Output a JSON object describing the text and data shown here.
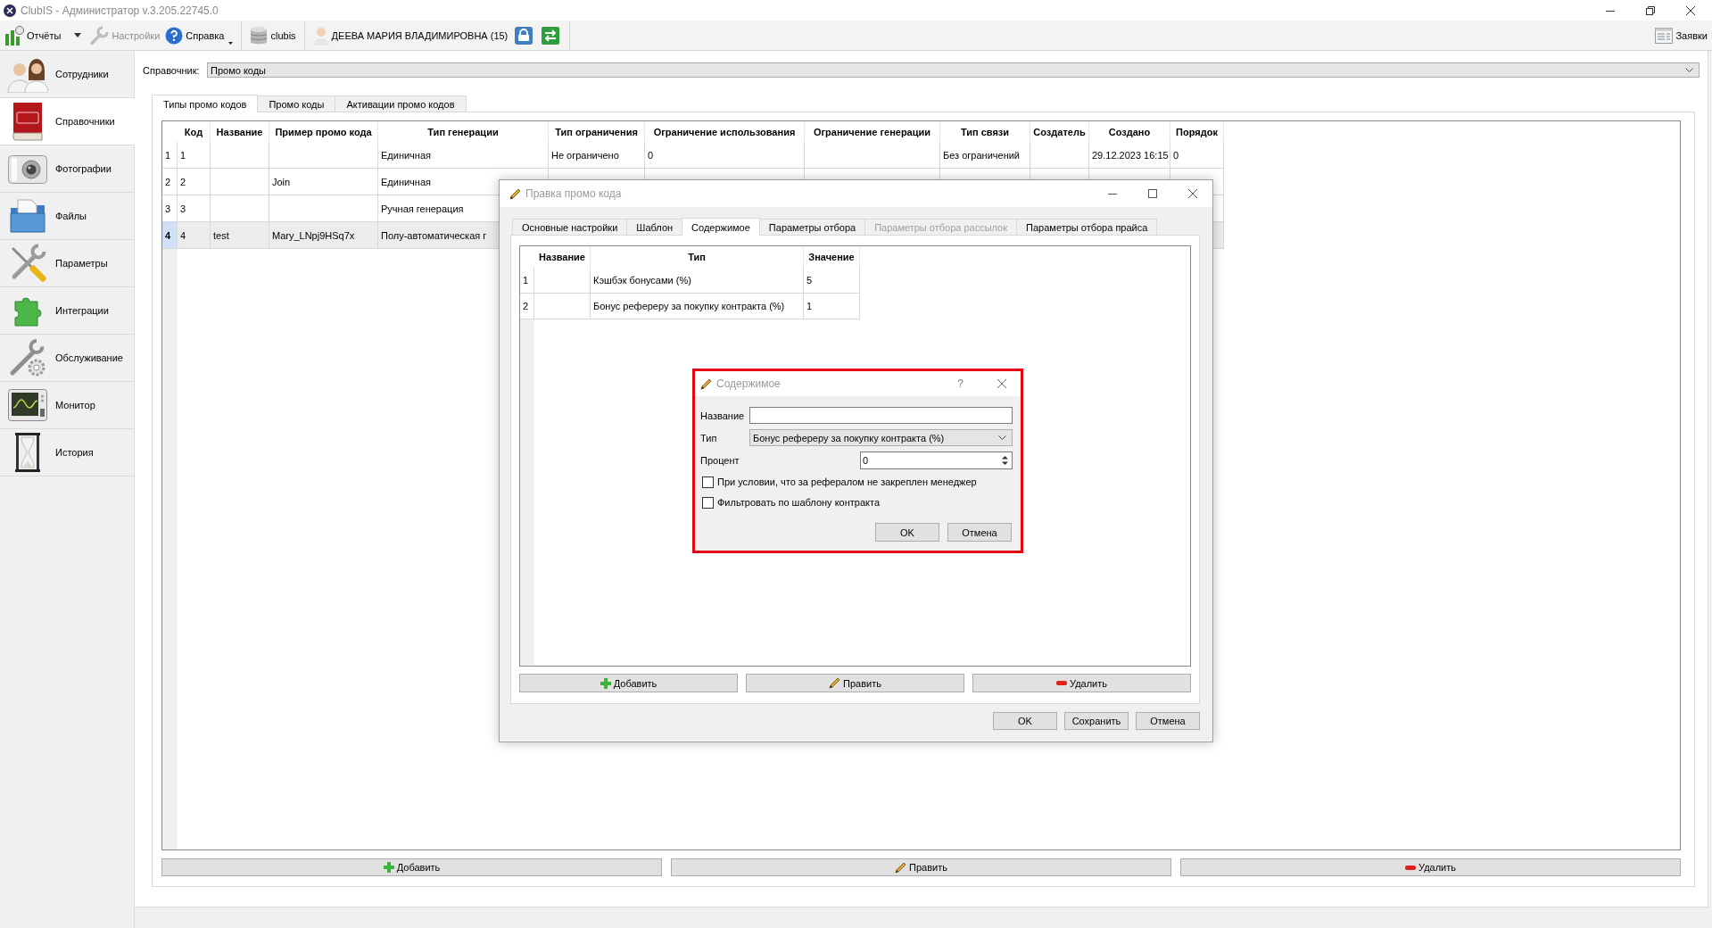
{
  "window": {
    "title": "ClubIS - Администратор v.3.205.22745.0"
  },
  "toolbar": {
    "items": [
      {
        "kind": "split",
        "label": "Отчёты",
        "disabled": false
      },
      {
        "kind": "button",
        "label": "Настройки",
        "disabled": true
      },
      {
        "kind": "menu",
        "label": "Справка",
        "disabled": false
      },
      {
        "kind": "separator"
      },
      {
        "kind": "button",
        "label": "clubis",
        "disabled": false
      },
      {
        "kind": "separator"
      },
      {
        "kind": "button",
        "label": "ДЕЕВА МАРИЯ ВЛАДИМИРОВНА (15)",
        "disabled": false
      },
      {
        "kind": "icon"
      },
      {
        "kind": "icon"
      },
      {
        "kind": "separator"
      }
    ],
    "right_items": [
      {
        "kind": "button",
        "label": "Заявки",
        "disabled": false
      }
    ]
  },
  "sidebar": {
    "items": [
      {
        "label": "Сотрудники",
        "selected": false
      },
      {
        "label": "Справочники",
        "selected": true
      },
      {
        "label": "Фотографии",
        "selected": false
      },
      {
        "label": "Файлы",
        "selected": false
      },
      {
        "label": "Параметры",
        "selected": false
      },
      {
        "label": "Интеграции",
        "selected": false
      },
      {
        "label": "Обслуживание",
        "selected": false
      },
      {
        "label": "Монитор",
        "selected": false
      },
      {
        "label": "История",
        "selected": false
      }
    ]
  },
  "directory": {
    "label": "Справочник:",
    "value": "Промо коды"
  },
  "tabs": [
    {
      "label": "Типы промо кодов",
      "selected": true
    },
    {
      "label": "Промо коды",
      "selected": false
    },
    {
      "label": "Активации промо кодов",
      "selected": false
    }
  ],
  "table": {
    "columns": [
      "Код",
      "Название",
      "Пример промо кода",
      "Тип генерации",
      "Тип ограничения",
      "Ограничение использования",
      "Ограничение генерации",
      "Тип связи",
      "Создатель",
      "Создано",
      "Порядок"
    ],
    "rows": [
      {
        "number": "1",
        "selected": false,
        "cells": [
          "1",
          null,
          null,
          "Единичная",
          "Не ограничено",
          "0",
          null,
          "Без ограничений",
          null,
          "29.12.2023 16:15",
          "0"
        ]
      },
      {
        "number": "2",
        "selected": false,
        "cells": [
          "2",
          null,
          "Join",
          "Единичная"
        ]
      },
      {
        "number": "3",
        "selected": false,
        "cells": [
          "3",
          null,
          null,
          "Ручная генерация"
        ]
      },
      {
        "number": "4",
        "selected": true,
        "cells": [
          "4",
          "test",
          "Mary_LNpj9HSq7x",
          "Полу-автоматическая г"
        ]
      }
    ]
  },
  "buttons": [
    "Добавить",
    "Править",
    "Удалить"
  ],
  "edit_dialog": {
    "title": "Правка промо кода",
    "tabs": [
      {
        "label": "Основные настройки",
        "selected": false,
        "disabled": false
      },
      {
        "label": "Шаблон",
        "selected": false,
        "disabled": false
      },
      {
        "label": "Содержимое",
        "selected": true,
        "disabled": false
      },
      {
        "label": "Параметры отбора",
        "selected": false,
        "disabled": false
      },
      {
        "label": "Параметры отбора рассылок",
        "selected": false,
        "disabled": true
      },
      {
        "label": "Параметры отбора прайса",
        "selected": false,
        "disabled": false
      }
    ],
    "table": {
      "columns": [
        "Название",
        "Тип",
        "Значение"
      ],
      "rows": [
        {
          "number": "1",
          "cells": [
            null,
            "Кэшбэк бонусами (%)",
            "5"
          ]
        },
        {
          "number": "2",
          "cells": [
            null,
            "Бонус рефереру за покупку контракта (%)",
            "1"
          ]
        }
      ]
    },
    "buttons": [
      "Добавить",
      "Править",
      "Удалить"
    ],
    "footer_buttons": [
      "OK",
      "Сохранить",
      "Отмена"
    ]
  },
  "content_dialog": {
    "title": "Содержимое",
    "help": "?",
    "highlighted": true,
    "fields": [
      {
        "kind": "text",
        "label": "Название"
      },
      {
        "kind": "combo",
        "label": "Тип",
        "value": "Бонус рефереру за покупку контракта (%)"
      },
      {
        "kind": "spin",
        "label": "Процент",
        "value": "0"
      }
    ],
    "checkboxes": [
      {
        "label": "При условии, что за рефералом не закреплен менеджер",
        "checked": false
      },
      {
        "label": "Фильтровать по шаблону контракта",
        "checked": false
      }
    ],
    "buttons": [
      "OK",
      "Отмена"
    ]
  }
}
